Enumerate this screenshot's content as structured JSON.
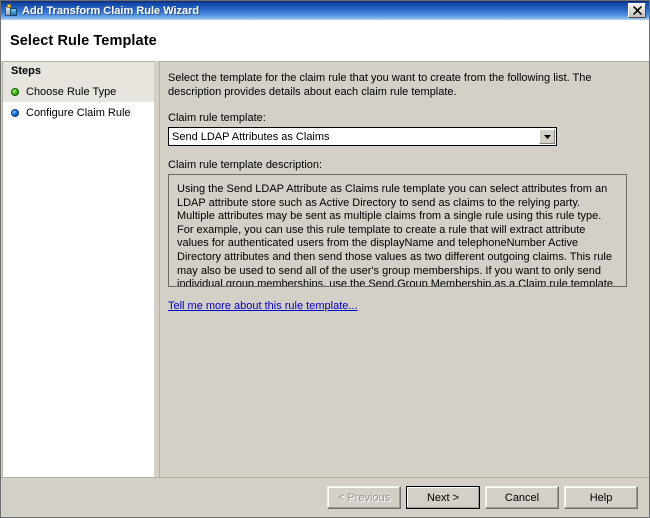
{
  "window": {
    "title": "Add Transform Claim Rule Wizard",
    "icon": "wizard-icon",
    "close_label": "close-icon"
  },
  "header": {
    "title": "Select Rule Template"
  },
  "sidebar": {
    "heading": "Steps",
    "items": [
      {
        "label": "Choose Rule Type",
        "state": "completed",
        "bullet_color": "#3aac12"
      },
      {
        "label": "Configure Claim Rule",
        "state": "current",
        "bullet_color": "#1273e0"
      }
    ]
  },
  "main": {
    "intro": "Select the template for the claim rule that you want to create from the following list. The description provides details about each claim rule template.",
    "template_label": "Claim rule template:",
    "template_selected": "Send LDAP Attributes as Claims",
    "template_options": [
      "Send LDAP Attributes as Claims"
    ],
    "description_label": "Claim rule template description:",
    "description": "Using the Send LDAP Attribute as Claims rule template you can select attributes from an LDAP attribute store such as Active Directory to send as claims to the relying party. Multiple attributes may be sent as multiple claims from a single rule using this rule type. For example, you can use this rule template to create a rule that will extract attribute values for authenticated users from the displayName and telephoneNumber Active Directory attributes and then send those values as two different outgoing claims. This rule may also be used to send all of the user's group memberships. If you want to only send individual group memberships, use the Send Group Membership as a Claim rule template.",
    "help_link": "Tell me more about this rule template..."
  },
  "footer": {
    "previous_label": "< Previous",
    "next_label": "Next >",
    "cancel_label": "Cancel",
    "help_label": "Help"
  },
  "colors": {
    "dialog_face": "#d4d0c8",
    "titlebar_blue": "#1349a8",
    "link_blue": "#0000c8",
    "step_done_green": "#3aac12",
    "step_current_blue": "#1273e0"
  }
}
